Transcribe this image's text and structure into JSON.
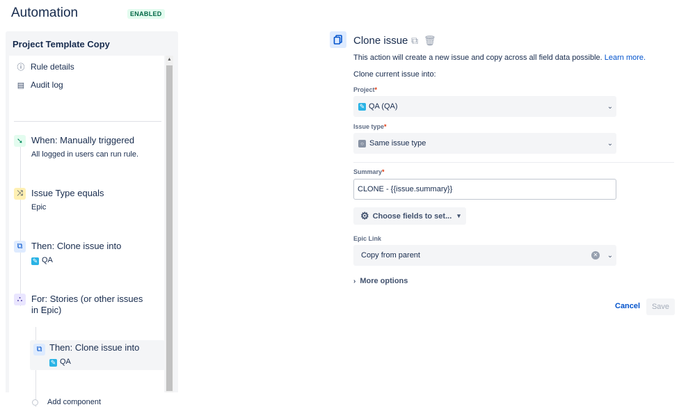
{
  "header": {
    "title": "Automation",
    "status_badge": "ENABLED"
  },
  "sidebar": {
    "title": "Project Template Copy",
    "menu": [
      {
        "label": "Rule details",
        "icon": "info-icon"
      },
      {
        "label": "Audit log",
        "icon": "document-icon"
      }
    ],
    "steps": {
      "trigger": {
        "title": "When: Manually triggered",
        "subtitle": "All logged in users can run rule."
      },
      "condition": {
        "title": "Issue Type equals",
        "subtitle": "Epic"
      },
      "action": {
        "title": "Then: Clone issue into",
        "project": "QA"
      },
      "branch": {
        "title_line1": "For: Stories (or other issues",
        "title_line2": "in Epic)"
      },
      "nested_action": {
        "title": "Then: Clone issue into",
        "project": "QA"
      },
      "add_component": "Add component"
    }
  },
  "panel": {
    "title": "Clone issue",
    "description": "This action will create a new issue and copy across all field data possible.",
    "learn_more": "Learn more.",
    "clone_into_label": "Clone current issue into:",
    "project": {
      "label": "Project",
      "required_mark": "*",
      "value": "QA (QA)"
    },
    "issue_type": {
      "label": "Issue type",
      "required_mark": "*",
      "value": "Same issue type"
    },
    "summary": {
      "label": "Summary",
      "required_mark": "*",
      "value": "CLONE - {{issue.summary}}"
    },
    "choose_fields": "Choose fields to set...",
    "epic_link": {
      "label": "Epic Link",
      "value": "Copy from parent"
    },
    "more_options": "More options",
    "cancel": "Cancel",
    "save": "Save"
  },
  "colors": {
    "accent": "#0052cc",
    "badge_bg": "#e3fcef",
    "badge_text": "#006644",
    "required": "#de350b"
  }
}
